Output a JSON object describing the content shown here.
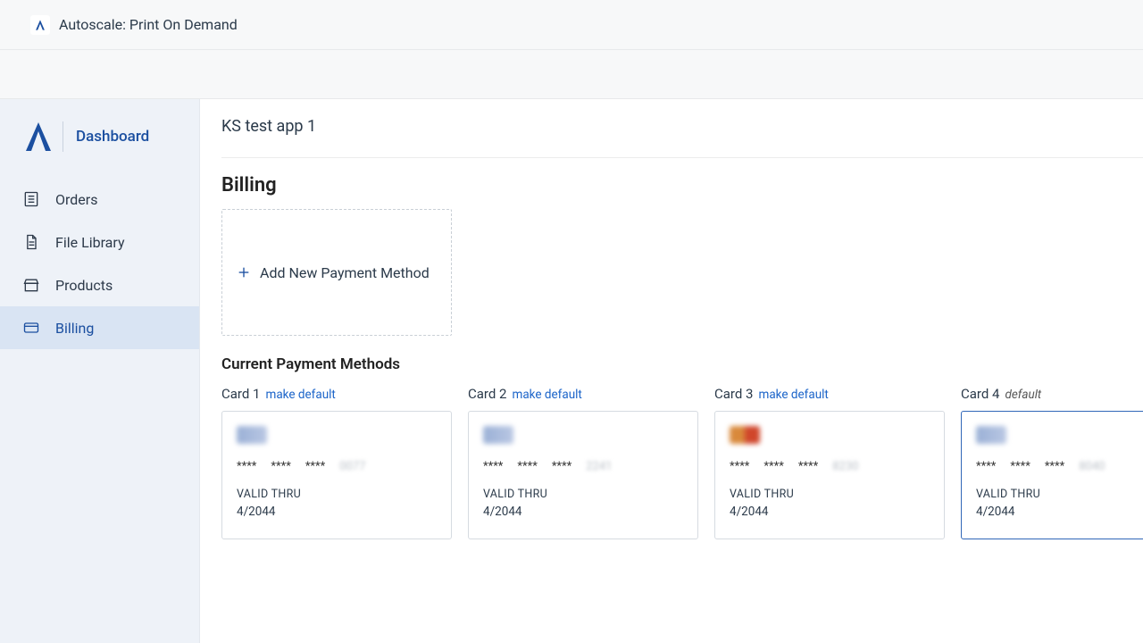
{
  "topbar": {
    "title": "Autoscale: Print On Demand"
  },
  "sidebar": {
    "title": "Dashboard",
    "items": [
      {
        "label": "Orders"
      },
      {
        "label": "File Library"
      },
      {
        "label": "Products"
      },
      {
        "label": "Billing"
      }
    ]
  },
  "content": {
    "app_name": "KS test app 1",
    "section_title": "Billing",
    "add_payment_label": "Add New Payment Method",
    "current_methods_title": "Current Payment Methods",
    "make_default_label": "make default",
    "default_tag": "default",
    "valid_thru_label": "VALID THRU",
    "masked_group": "****",
    "cards": [
      {
        "label": "Card 1",
        "brand": "visa",
        "last": "0077",
        "exp": "4/2044",
        "default": false
      },
      {
        "label": "Card 2",
        "brand": "visa",
        "last": "2241",
        "exp": "4/2044",
        "default": false
      },
      {
        "label": "Card 3",
        "brand": "mc",
        "last": "8230",
        "exp": "4/2044",
        "default": false
      },
      {
        "label": "Card 4",
        "brand": "visa",
        "last": "8040",
        "exp": "4/2044",
        "default": true
      }
    ]
  }
}
